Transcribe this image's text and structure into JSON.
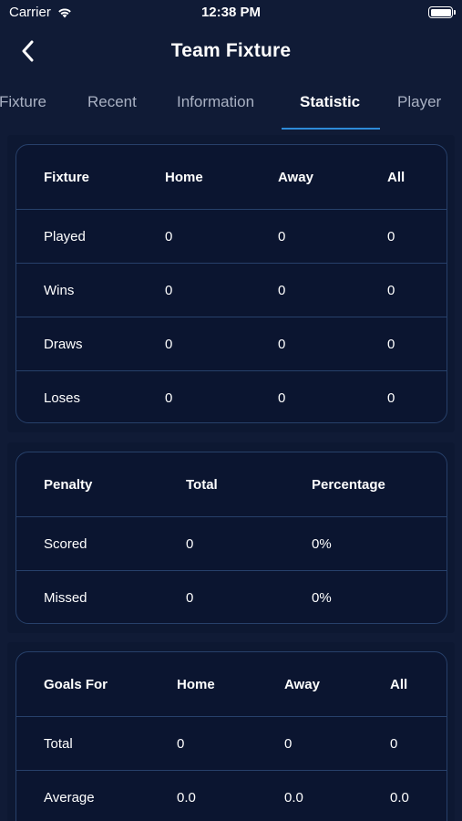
{
  "status_bar": {
    "carrier": "Carrier",
    "time": "12:38 PM"
  },
  "nav": {
    "title": "Team Fixture"
  },
  "tabs": [
    {
      "label": "Fixture"
    },
    {
      "label": "Recent"
    },
    {
      "label": "Information"
    },
    {
      "label": "Statistic",
      "active": true
    },
    {
      "label": "Player"
    }
  ],
  "fixture_table": {
    "headers": [
      "Fixture",
      "Home",
      "Away",
      "All"
    ],
    "rows": [
      [
        "Played",
        "0",
        "0",
        "0"
      ],
      [
        "Wins",
        "0",
        "0",
        "0"
      ],
      [
        "Draws",
        "0",
        "0",
        "0"
      ],
      [
        "Loses",
        "0",
        "0",
        "0"
      ]
    ]
  },
  "penalty_table": {
    "headers": [
      "Penalty",
      "Total",
      "Percentage"
    ],
    "rows": [
      [
        "Scored",
        "0",
        "0%"
      ],
      [
        "Missed",
        "0",
        "0%"
      ]
    ]
  },
  "goals_for_table": {
    "headers": [
      "Goals For",
      "Home",
      "Away",
      "All"
    ],
    "rows": [
      [
        "Total",
        "0",
        "0",
        "0"
      ],
      [
        "Average",
        "0.0",
        "0.0",
        "0.0"
      ]
    ]
  },
  "colors": {
    "background": "#101b36",
    "card_border": "#27406a",
    "tab_accent": "#2e8bd8",
    "inactive_tab": "#a9b1c3"
  }
}
